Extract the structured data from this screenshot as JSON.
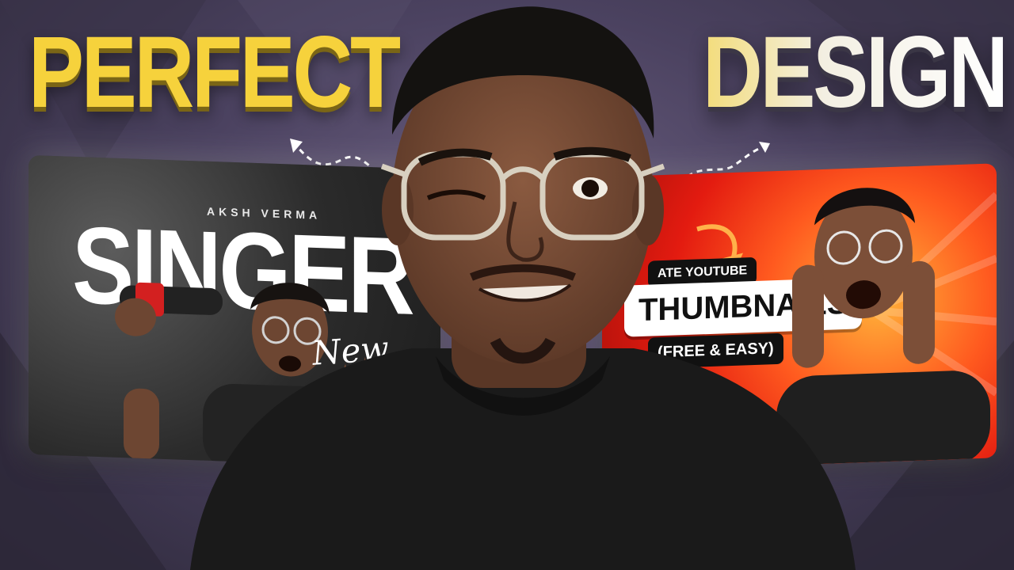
{
  "headline": {
    "left": "PERFECT",
    "right": "DESIGN"
  },
  "card_left": {
    "subtitle": "AKSH VERMA",
    "title": "SINGER",
    "script": "New Song"
  },
  "card_right": {
    "label_top": "ATE YOUTUBE",
    "label_main": "THUMBNAILS",
    "label_bottom": "(FREE & EASY)"
  },
  "colors": {
    "yellow": "#f6d23c",
    "red": "#e31b10",
    "orange": "#ff5a1f",
    "bg": "#4b4260"
  },
  "icons": [
    "dashed-curved-arrow-left",
    "dashed-curved-arrow-right",
    "orange-curved-arrow"
  ]
}
